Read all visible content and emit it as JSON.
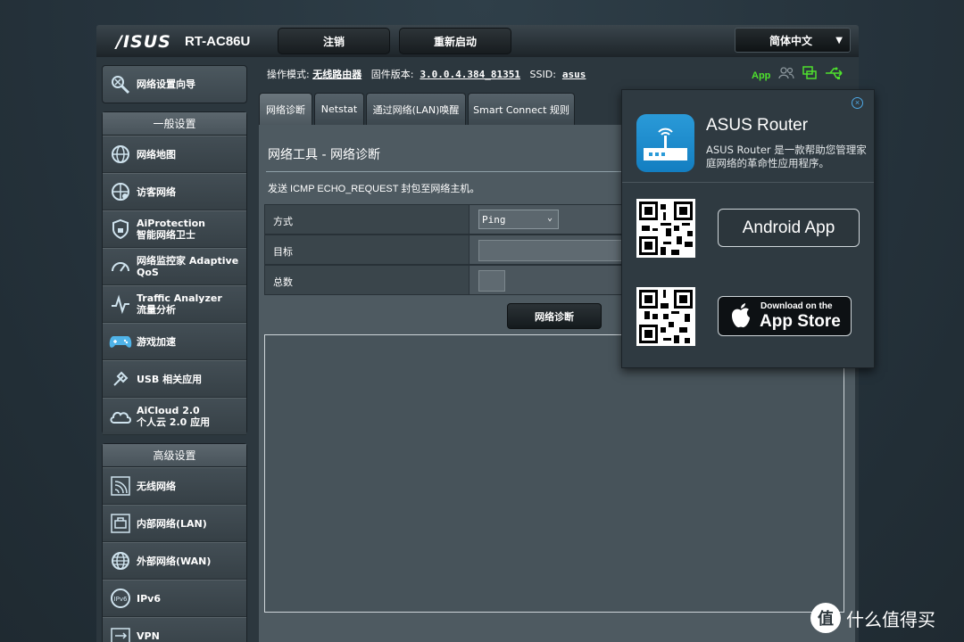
{
  "header": {
    "brand": "/ISUS",
    "model": "RT-AC86U",
    "logout_label": "注销",
    "reboot_label": "重新启动",
    "language": "简体中文"
  },
  "status": {
    "mode_label": "操作模式:",
    "mode_value": "无线路由器",
    "firmware_label": "固件版本:",
    "firmware_value": "3.0.0.4.384_81351",
    "ssid_label": "SSID:",
    "ssid_value": "asus",
    "app_label": "App"
  },
  "sidebar": {
    "wizard_label": "网络设置向导",
    "general_heading": "一般设置",
    "general_items": [
      {
        "line1": "网络地图",
        "line2": ""
      },
      {
        "line1": "访客网络",
        "line2": ""
      },
      {
        "line1": "AiProtection",
        "line2": "智能网络卫士"
      },
      {
        "line1": "网络监控家 Adaptive",
        "line2": "QoS"
      },
      {
        "line1": "Traffic Analyzer",
        "line2": "流量分析"
      },
      {
        "line1": "游戏加速",
        "line2": ""
      },
      {
        "line1": "USB 相关应用",
        "line2": ""
      },
      {
        "line1": "AiCloud 2.0",
        "line2": "个人云 2.0 应用"
      }
    ],
    "advanced_heading": "高级设置",
    "advanced_items": [
      {
        "line1": "无线网络",
        "line2": ""
      },
      {
        "line1": "内部网络(LAN)",
        "line2": ""
      },
      {
        "line1": "外部网络(WAN)",
        "line2": ""
      },
      {
        "line1": "IPv6",
        "line2": ""
      },
      {
        "line1": "VPN",
        "line2": ""
      }
    ]
  },
  "tabs": [
    {
      "label": "网络诊断",
      "active": true
    },
    {
      "label": "Netstat",
      "active": false
    },
    {
      "label": "通过网络(LAN)唤醒",
      "active": false
    },
    {
      "label": "Smart Connect 规则",
      "active": false
    }
  ],
  "content": {
    "title": "网络工具 - 网络诊断",
    "description": "发送 ICMP ECHO_REQUEST 封包至网络主机。",
    "fields": [
      {
        "label": "方式",
        "value": "Ping"
      },
      {
        "label": "目标",
        "value": ""
      },
      {
        "label": "总数",
        "value": ""
      }
    ],
    "diagnose_button": "网络诊断"
  },
  "popup": {
    "title": "ASUS Router",
    "description": "ASUS Router 是一款帮助您管理家庭网络的革命性应用程序。",
    "android_button": "Android App",
    "appstore_small": "Download on the",
    "appstore_big": "App Store",
    "close_glyph": "×"
  },
  "watermark": {
    "glyph": "值",
    "text": "什么值得买"
  },
  "colors": {
    "accent_green": "#4ee12d",
    "accent_blue": "#2a9ad8",
    "panel": "#4e5a61"
  }
}
